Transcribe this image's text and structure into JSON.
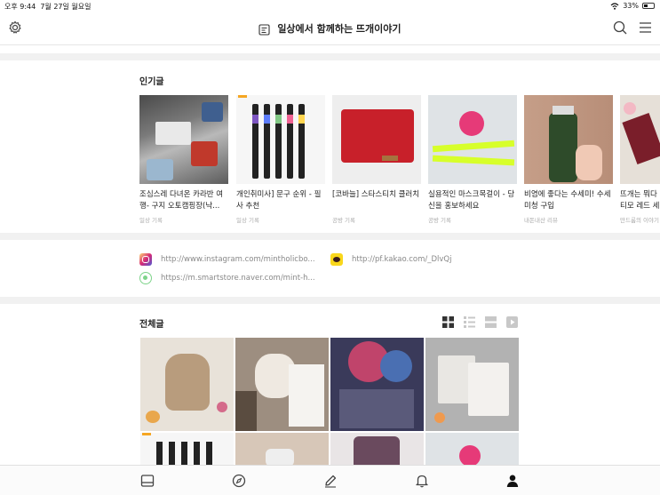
{
  "status": {
    "time": "오후 9:44",
    "date": "7월 27일 월요일",
    "battery": "33%"
  },
  "header": {
    "title": "일상에서 함께하는 뜨개이야기"
  },
  "popular": {
    "title": "인기글",
    "items": [
      {
        "title": "조심스레 다녀온 카라반 여행- 구지 오토캠핑장(낙...",
        "category": "일상 기록"
      },
      {
        "title": "개인취미사] 문구 순위 - 필사 추천",
        "category": "일상 기록"
      },
      {
        "title": "[코바늘] 스타스티치 클러치",
        "category": "공방 기록"
      },
      {
        "title": "실용적인 마스크목걸이 - 당신을 홍보하세요",
        "category": "공방 기록"
      },
      {
        "title": "비염에 좋다는 수세미! 수세미청 구입",
        "category": "내돈내산 리뷰"
      },
      {
        "title": "뜨개는 뭐다 티모 레드 세",
        "category": "만드룸의 이야기"
      }
    ]
  },
  "links": {
    "instagram": "http://www.instagram.com/mintholicbo...",
    "kakao": "http://pf.kakao.com/_DlvQj",
    "smartstore": "https://m.smartstore.naver.com/mint-h..."
  },
  "all_posts": {
    "title": "전체글"
  },
  "icons": {
    "settings": "gear-icon",
    "search": "search-icon",
    "menu": "hamburger-menu-icon",
    "tab_home": "blog-home-icon",
    "tab_explore": "compass-icon",
    "tab_write": "pencil-icon",
    "tab_notify": "bell-icon",
    "tab_profile": "person-icon"
  },
  "colors": {
    "accent": "#222222",
    "separator": "#f1f1f1",
    "link_text": "#888888",
    "kakao": "#f9d71c",
    "instagram": "#c13584",
    "naver": "#5ac451"
  }
}
